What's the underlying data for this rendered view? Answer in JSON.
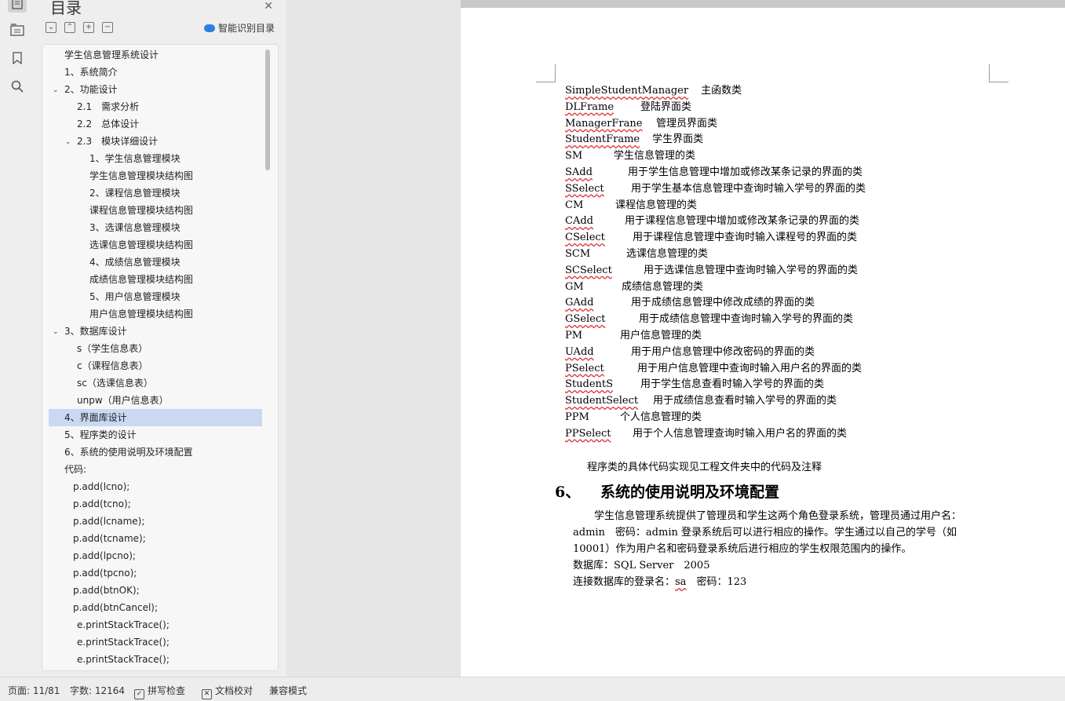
{
  "toc": {
    "title": "目录",
    "smart_label": "智能识别目录",
    "items": [
      {
        "label": "学生信息管理系统设计",
        "level": 1,
        "arrow": ""
      },
      {
        "label": "1、系统简介",
        "level": 1,
        "arrow": ""
      },
      {
        "label": "2、功能设计",
        "level": 1,
        "arrow": "⌄"
      },
      {
        "label": "2.1　需求分析",
        "level": 2,
        "arrow": ""
      },
      {
        "label": "2.2　总体设计",
        "level": 2,
        "arrow": ""
      },
      {
        "label": "2.3　模块详细设计",
        "level": 2,
        "arrow": "⌄"
      },
      {
        "label": "1、学生信息管理模块",
        "level": 3,
        "arrow": ""
      },
      {
        "label": "学生信息管理模块结构图",
        "level": 3,
        "arrow": ""
      },
      {
        "label": "2、课程信息管理模块",
        "level": 3,
        "arrow": ""
      },
      {
        "label": "课程信息管理模块结构图",
        "level": 3,
        "arrow": ""
      },
      {
        "label": "3、选课信息管理模块",
        "level": 3,
        "arrow": ""
      },
      {
        "label": "选课信息管理模块结构图",
        "level": 3,
        "arrow": ""
      },
      {
        "label": "4、成绩信息管理模块",
        "level": 3,
        "arrow": ""
      },
      {
        "label": "成绩信息管理模块结构图",
        "level": 3,
        "arrow": ""
      },
      {
        "label": "5、用户信息管理模块",
        "level": 3,
        "arrow": ""
      },
      {
        "label": "用户信息管理模块结构图",
        "level": 3,
        "arrow": ""
      },
      {
        "label": "3、数据库设计",
        "level": 1,
        "arrow": "⌄"
      },
      {
        "label": "s（学生信息表）",
        "level": 2,
        "arrow": ""
      },
      {
        "label": "c（课程信息表）",
        "level": 2,
        "arrow": ""
      },
      {
        "label": "sc（选课信息表）",
        "level": 2,
        "arrow": ""
      },
      {
        "label": "unpw（用户信息表）",
        "level": 2,
        "arrow": ""
      },
      {
        "label": "4、界面库设计",
        "level": 1,
        "arrow": "",
        "selected": true
      },
      {
        "label": "5、程序类的设计",
        "level": 1,
        "arrow": ""
      },
      {
        "label": "6、系统的使用说明及环境配置",
        "level": 1,
        "arrow": ""
      },
      {
        "label": "代码:",
        "level": 1,
        "arrow": ""
      },
      {
        "label": "p.add(lcno);",
        "level": 1.5,
        "arrow": ""
      },
      {
        "label": "p.add(tcno);",
        "level": 1.5,
        "arrow": ""
      },
      {
        "label": "p.add(lcname);",
        "level": 1.5,
        "arrow": ""
      },
      {
        "label": "p.add(tcname);",
        "level": 1.5,
        "arrow": ""
      },
      {
        "label": "p.add(lpcno);",
        "level": 1.5,
        "arrow": ""
      },
      {
        "label": "p.add(tpcno);",
        "level": 1.5,
        "arrow": ""
      },
      {
        "label": "p.add(btnOK);",
        "level": 1.5,
        "arrow": ""
      },
      {
        "label": "p.add(btnCancel);",
        "level": 1.5,
        "arrow": ""
      },
      {
        "label": "e.printStackTrace();",
        "level": 1.8,
        "arrow": ""
      },
      {
        "label": "e.printStackTrace();",
        "level": 1.8,
        "arrow": ""
      },
      {
        "label": "e.printStackTrace();",
        "level": 1.8,
        "arrow": ""
      }
    ]
  },
  "document": {
    "classes": [
      {
        "name": "SimpleStudentManager",
        "desc": "主函数类",
        "wavy": true
      },
      {
        "name": "DLFrame",
        "desc": "登陆界面类",
        "wavy": true
      },
      {
        "name": "ManagerFrane",
        "desc": "管理员界面类",
        "wavy": true
      },
      {
        "name": "StudentFrame",
        "desc": "学生界面类",
        "wavy": true
      },
      {
        "name": "SM",
        "desc": "学生信息管理的类",
        "wavy": false
      },
      {
        "name": "SAdd",
        "desc": "用于学生信息管理中增加或修改某条记录的界面的类",
        "wavy": true
      },
      {
        "name": "SSelect",
        "desc": "用于学生基本信息管理中查询时输入学号的界面的类",
        "wavy": true
      },
      {
        "name": "CM",
        "desc": "课程信息管理的类",
        "wavy": false
      },
      {
        "name": "CAdd",
        "desc": "用于课程信息管理中增加或修改某条记录的界面的类",
        "wavy": true
      },
      {
        "name": "CSelect",
        "desc": "用于课程信息管理中查询时输入课程号的界面的类",
        "wavy": true
      },
      {
        "name": "SCM",
        "desc": "选课信息管理的类",
        "wavy": false
      },
      {
        "name": "SCSelect",
        "desc": "用于选课信息管理中查询时输入学号的界面的类",
        "wavy": true
      },
      {
        "name": "GM",
        "desc": "成绩信息管理的类",
        "wavy": false
      },
      {
        "name": "GAdd",
        "desc": "用于成绩信息管理中修改成绩的界面的类",
        "wavy": true
      },
      {
        "name": "GSelect",
        "desc": "用于成绩信息管理中查询时输入学号的界面的类",
        "wavy": true
      },
      {
        "name": "PM",
        "desc": "用户信息管理的类",
        "wavy": false
      },
      {
        "name": "UAdd",
        "desc": "用于用户信息管理中修改密码的界面的类",
        "wavy": true
      },
      {
        "name": "PSelect",
        "desc": "用于用户信息管理中查询时输入用户名的界面的类",
        "wavy": true
      },
      {
        "name": "StudentS",
        "desc": "用于学生信息查看时输入学号的界面的类",
        "wavy": true
      },
      {
        "name": "StudentSelect",
        "desc": "用于成绩信息查看时输入学号的界面的类",
        "wavy": true
      },
      {
        "name": "PPM",
        "desc": "个人信息管理的类",
        "wavy": false
      },
      {
        "name": "PPSelect",
        "desc": "用于个人信息管理查询时输入用户名的界面的类",
        "wavy": true
      }
    ],
    "note": "程序类的具体代码实现见工程文件夹中的代码及注释",
    "heading_num": "6、",
    "heading_text": "系统的使用说明及环境配置",
    "para1": "学生信息管理系统提供了管理员和学生这两个角色登录系统，管理员通过用户名：",
    "para2": "admin　密码：admin 登录系统后可以进行相应的操作。学生通过以自己的学号（如",
    "para3": "10001）作为用户名和密码登录系统后进行相应的学生权限范围内的操作。",
    "db_line": "数据库：SQL Server　2005",
    "login_prefix": "连接数据库的登录名：",
    "login_user": "sa",
    "login_pwd": "　密码：123"
  },
  "status": {
    "page": "页面: 11/81",
    "words": "字数: 12164",
    "spell": "拼写检查",
    "proof": "文档校对",
    "compat": "兼容模式"
  }
}
